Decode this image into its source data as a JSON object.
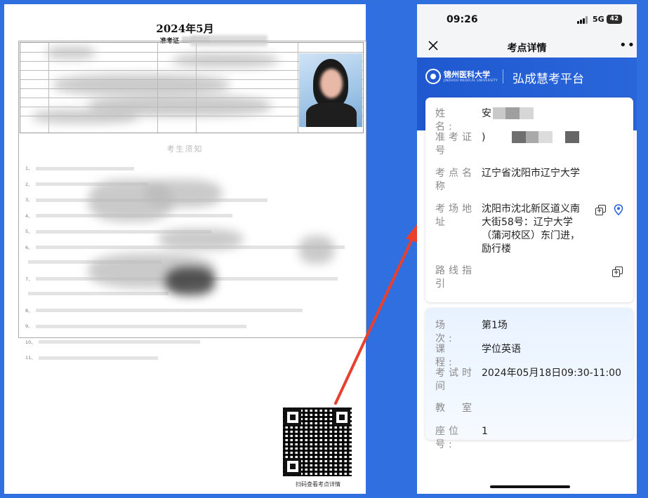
{
  "ticket": {
    "title": "2024年5月",
    "subtitle": "准考证",
    "notice_title": "考生须知",
    "notice_numbers": [
      "1、",
      "2、",
      "3、",
      "4、",
      "5、",
      "6、",
      "",
      "7、",
      "",
      "8、",
      "9、",
      "10、",
      "11、"
    ],
    "qr_caption": "扫码查看考点详情"
  },
  "phone": {
    "status": {
      "time": "09:26",
      "network": "5G",
      "battery": "42"
    },
    "nav": {
      "title": "考点详情"
    },
    "banner": {
      "university": "锦州医科大学",
      "university_en": "JINZHOU MEDICAL UNIVERSITY",
      "platform": "弘成慧考平台"
    },
    "card1": {
      "name_label": "姓　名:",
      "name_value": "安",
      "ticket_label": "准考证号",
      "ticket_value": ")",
      "site_label": "考点名称",
      "site_value": "辽宁省沈阳市辽宁大学",
      "address_label": "考场地址",
      "address_value": "沈阳市沈北新区道义南大街58号：辽宁大学（蒲河校区）东门进，励行楼",
      "route_label": "路线指引"
    },
    "card2": {
      "session_label": "场　次:",
      "session_value": "第1场",
      "course_label": "课　程:",
      "course_value": "学位英语",
      "time_label": "考试时间",
      "time_value": "2024年05月18日09:30-11:00",
      "room_label": "教　室",
      "seat_label": "座位号:",
      "seat_value": "1"
    }
  },
  "colors": {
    "background": "#2f6fe0",
    "banner": "#1f58cf",
    "arrow": "#e8402e"
  }
}
